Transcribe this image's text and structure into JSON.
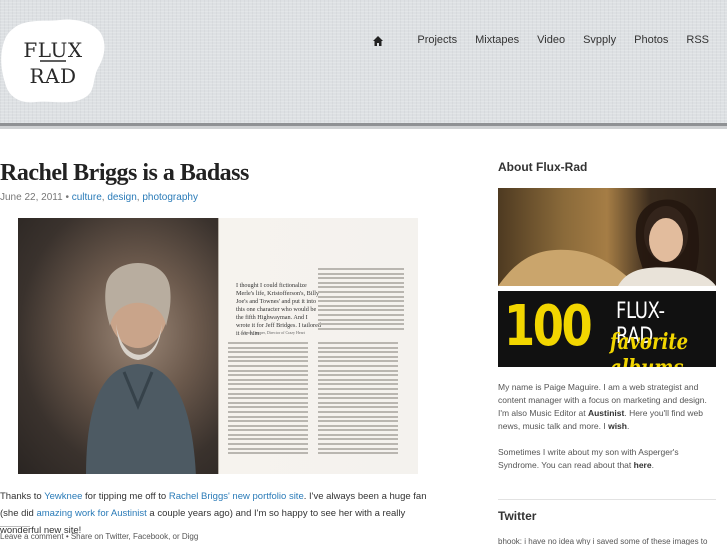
{
  "header": {
    "logo_top": "FLUX",
    "logo_bottom": "RAD",
    "nav": {
      "home_icon": "home-icon",
      "items": [
        "Projects",
        "Mixtapes",
        "Video",
        "Svpply",
        "Photos",
        "RSS"
      ]
    }
  },
  "post": {
    "title": "Rachel Briggs is a Badass",
    "date": "June 22, 2011",
    "separator": "•",
    "categories": [
      "culture",
      "design",
      "photography"
    ],
    "image_quote": "I thought I could fictionalize Merle's life, Kristofferson's, Billy Joe's and Townes' and put it into this one character who would be the fifth Highwayman. And I wrote it for Jeff Bridges. I tailored it for him.",
    "image_quote_credit": "—Scott Cooper, Director of Crazy Heart",
    "body": {
      "p1": "Thanks to ",
      "link1": "Yewknee",
      "p2": " for tipping me off to ",
      "link2": "Rachel Briggs' new portfolio site",
      "p3": ". I've always been a huge fan (she did ",
      "link3": "amazing work for Austinist",
      "p4": " a couple years ago) and I'm so happy to see her with a really wonderful new site!"
    },
    "footer": "Leave a comment • Share on Twitter, Facebook, or Digg"
  },
  "sidebar": {
    "about_heading": "About Flux-Rad",
    "albums_number": "100",
    "albums_brand": "FLUX-RAD",
    "albums_sub": "favorite albums",
    "bio": {
      "t1": "My name is Paige Maguire. I am a web strategist and content manager with a focus on marketing and design. I'm also Music Editor at ",
      "b1": "Austinist",
      "t2": ". Here you'll find web news, music talk and more. I ",
      "b2": "wish",
      "t3": "."
    },
    "bio2": {
      "t1": "Sometimes I write about my son with Asperger's Syndrome. You can read about that ",
      "b1": "here",
      "t2": "."
    },
    "twitter_heading": "Twitter",
    "tweet_preview": "bhook: i have no idea why i saved some of these images to"
  },
  "colors": {
    "link": "#2a7bb8",
    "header_bg": "#dde0e3",
    "albums_yellow": "#f2d600"
  }
}
